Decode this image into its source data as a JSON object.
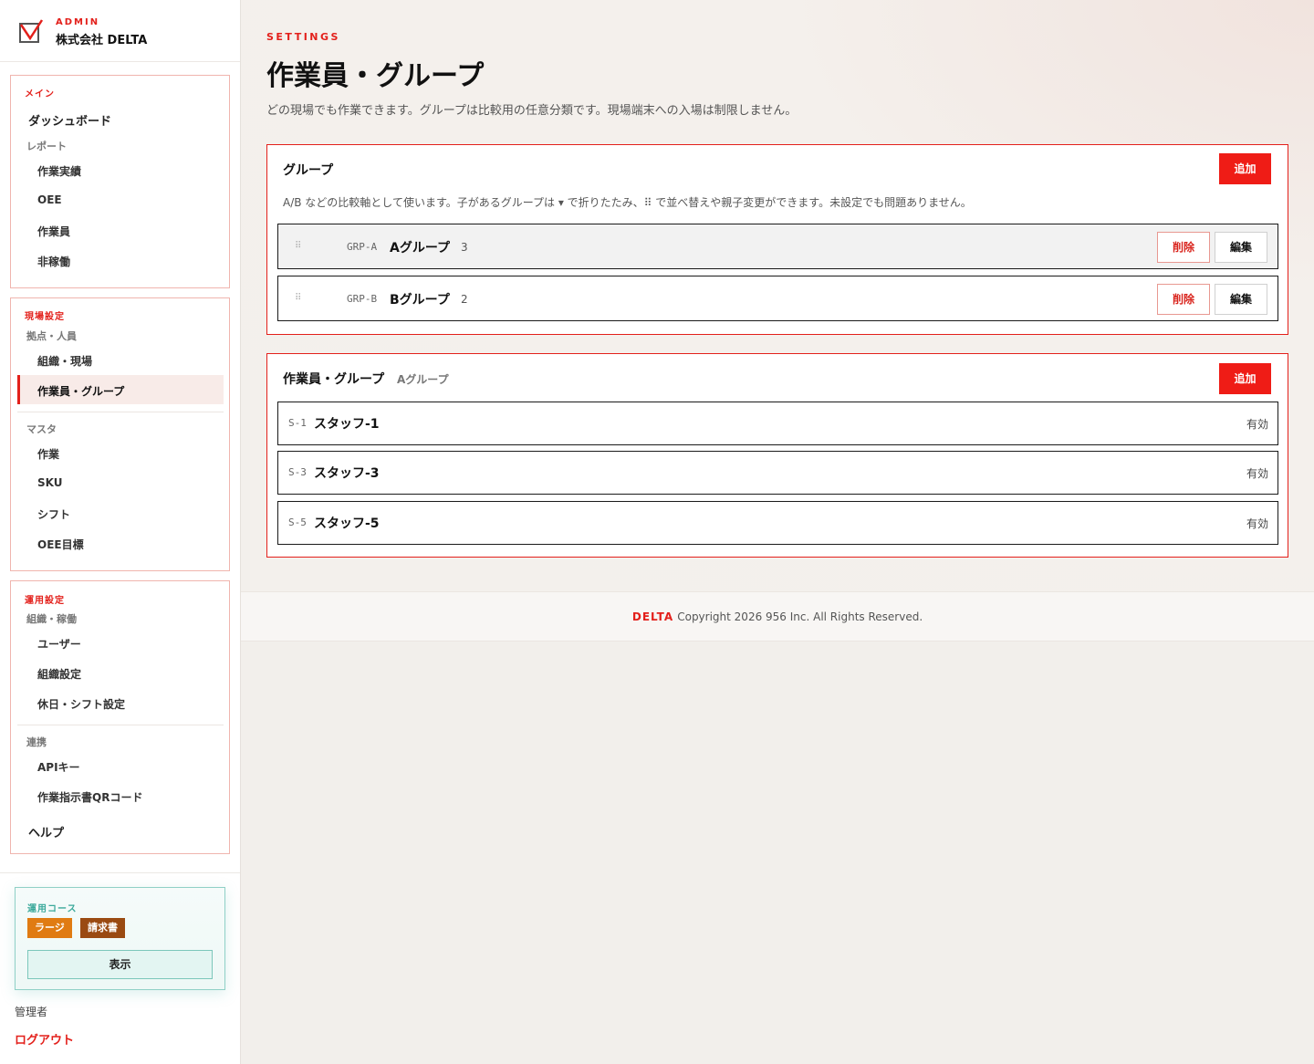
{
  "brand": {
    "admin_label": "ADMIN",
    "company": "株式会社 DELTA"
  },
  "sidebar": {
    "main": {
      "section": "メイン",
      "dashboard": "ダッシュボード",
      "reports_label": "レポート",
      "reports": [
        "作業実績",
        "OEE",
        "作業員",
        "非稼働"
      ]
    },
    "site": {
      "section": "現場設定",
      "sub1": "拠点・人員",
      "items1": [
        "組織・現場",
        "作業員・グループ"
      ],
      "active_index": 1,
      "sub2": "マスタ",
      "items2": [
        "作業",
        "SKU",
        "シフト",
        "OEE目標"
      ]
    },
    "ops": {
      "section": "運用設定",
      "sub1": "組織・稼働",
      "items1": [
        "ユーザー",
        "組織設定",
        "休日・シフト設定"
      ],
      "sub2": "連携",
      "items2": [
        "APIキー",
        "作業指示書QRコード"
      ],
      "help": "ヘルプ"
    },
    "plan": {
      "label": "運用コース",
      "badges": [
        "ラージ",
        "請求書"
      ],
      "view_button": "表示"
    },
    "user_role": "管理者",
    "logout": "ログアウト"
  },
  "page": {
    "eyebrow": "SETTINGS",
    "title": "作業員・グループ",
    "description": "どの現場でも作業できます。グループは比較用の任意分類です。現場端末への入場は制限しません。"
  },
  "groups_panel": {
    "title": "グループ",
    "add_button": "追加",
    "note": "A/B などの比較軸として使います。子があるグループは ▾ で折りたたみ、⠿ で並べ替えや親子変更ができます。未設定でも問題ありません。",
    "rows": [
      {
        "code": "GRP-A",
        "name": "Aグループ",
        "count": "3",
        "delete": "削除",
        "edit": "編集"
      },
      {
        "code": "GRP-B",
        "name": "Bグループ",
        "count": "2",
        "delete": "削除",
        "edit": "編集"
      }
    ]
  },
  "members_panel": {
    "title": "作業員・グループ",
    "subtitle": "Aグループ",
    "add_button": "追加",
    "rows": [
      {
        "code": "S-1",
        "name": "スタッフ-1",
        "status": "有効"
      },
      {
        "code": "S-3",
        "name": "スタッフ-3",
        "status": "有効"
      },
      {
        "code": "S-5",
        "name": "スタッフ-5",
        "status": "有効"
      }
    ]
  },
  "footer": {
    "brand": "DELTA",
    "copyright": "Copyright 2026 956 Inc. All Rights Reserved."
  },
  "colors": {
    "accent": "#e3201b",
    "plan_accent": "#3ba99b",
    "badge_orange": "#e07b12",
    "badge_brown": "#9a4a12"
  }
}
